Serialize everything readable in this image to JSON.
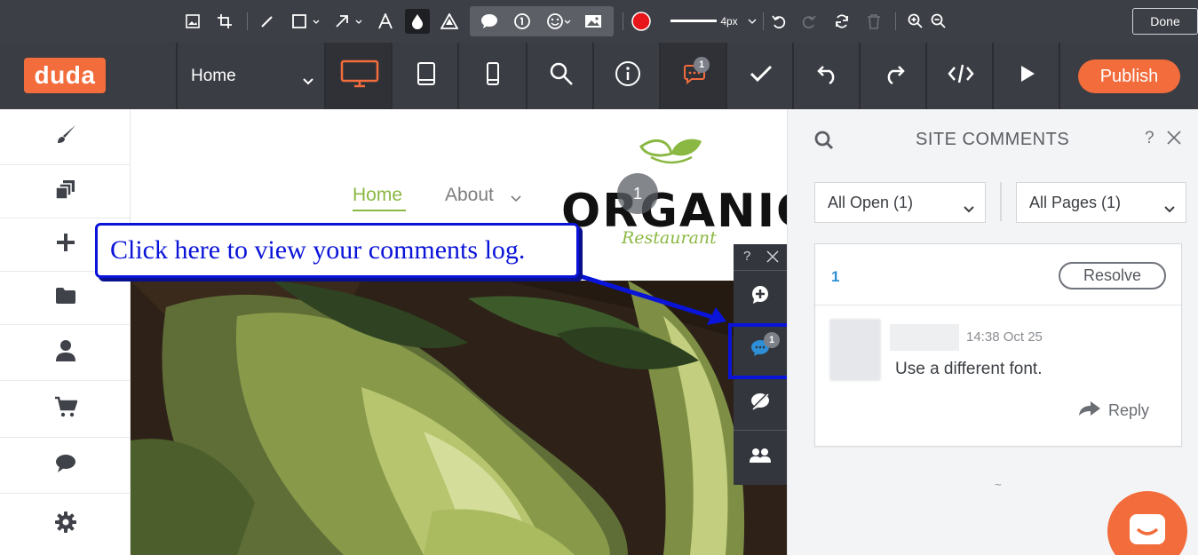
{
  "annotation_toolbar": {
    "stroke_size": "4px",
    "done_label": "Done",
    "record_color": "#e8161b"
  },
  "topbar": {
    "logo": "duda",
    "page_select": "Home",
    "comments_badge": "1",
    "publish_label": "Publish"
  },
  "canvas": {
    "nav_home": "Home",
    "nav_about": "About",
    "brand": "ORGANIC",
    "brand_sub": "Restaurant",
    "pin_number": "1"
  },
  "callout": {
    "text": "Click here to view your comments log."
  },
  "tool_panel": {
    "help": "?",
    "comments_badge": "1"
  },
  "comments_panel": {
    "title": "SITE COMMENTS",
    "help": "?",
    "filter_status": "All Open (1)",
    "filter_pages": "All Pages (1)",
    "comment": {
      "number": "1",
      "resolve_label": "Resolve",
      "timestamp": "14:38 Oct 25",
      "text": "Use a different font.",
      "reply_label": "Reply"
    },
    "loader": "~"
  },
  "colors": {
    "brand_orange": "#f26c3c",
    "annotation_blue": "#0a14d8",
    "accent_green": "#8bb843",
    "comment_blue": "#2e8fd6"
  }
}
